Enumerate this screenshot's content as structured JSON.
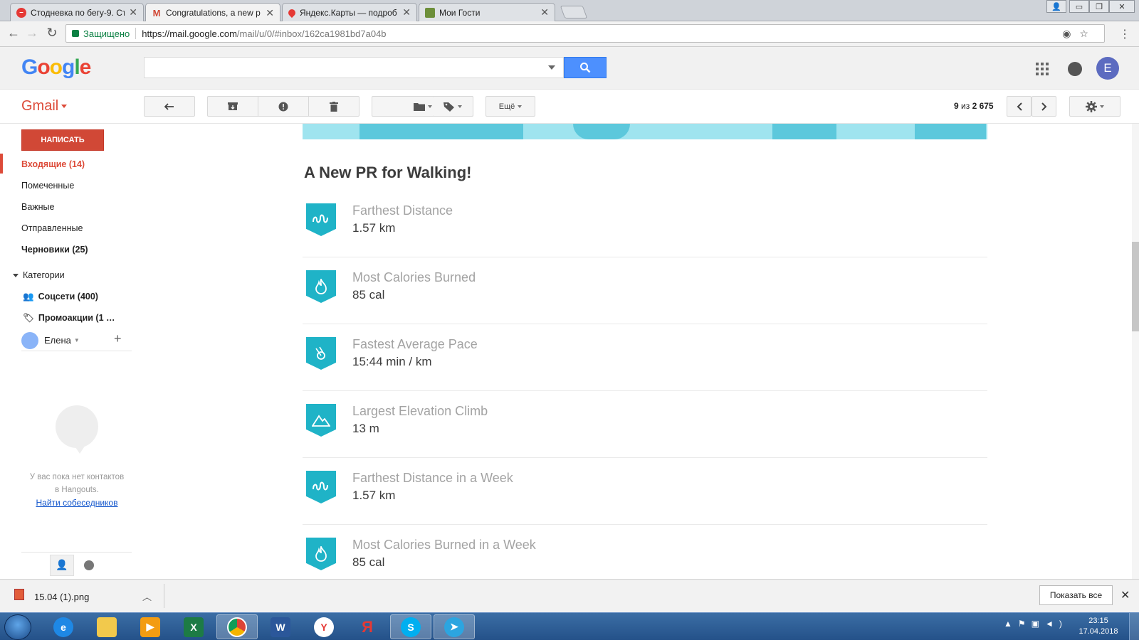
{
  "browser": {
    "tabs": [
      {
        "title": "Стодневка по бегу-9. Ст",
        "icon": "red-stop-icon",
        "color": "#e53935"
      },
      {
        "title": "Congratulations, a new p",
        "icon": "gmail-icon",
        "color": "#d14836",
        "active": true
      },
      {
        "title": "Яндекс.Карты — подроб",
        "icon": "map-pin-icon",
        "color": "#e53935"
      },
      {
        "title": "Мои Гости",
        "icon": "site-favicon",
        "color": "#6d8f3a"
      }
    ],
    "secure_label": "Защищено",
    "url_host": "https://mail.google.com",
    "url_path": "/mail/u/0/#inbox/162ca1981bd7a04b"
  },
  "header": {
    "logo_letters": [
      "G",
      "o",
      "o",
      "g",
      "l",
      "e"
    ],
    "avatar_letter": "E"
  },
  "toolbar": {
    "gmail_label": "Gmail",
    "more_label": "Ещё",
    "pager_current": "9",
    "pager_mid": " из ",
    "pager_total": "2 675"
  },
  "sidebar": {
    "compose_label": "НАПИСАТЬ",
    "items": [
      {
        "label": "Входящие (14)"
      },
      {
        "label": "Помеченные"
      },
      {
        "label": "Важные"
      },
      {
        "label": "Отправленные"
      },
      {
        "label": "Черновики (25)"
      }
    ],
    "categories_label": "Категории",
    "social_label": "Соцсети (400)",
    "promo_label": "Промоакции (1 …",
    "user_name": "Елена",
    "hangouts_text_1": "У вас пока нет контактов",
    "hangouts_text_2": "в Hangouts.",
    "hangouts_link": "Найти собеседников"
  },
  "mail": {
    "title": "A New PR for Walking!",
    "records": [
      {
        "label": "Farthest Distance",
        "value": "1.57 km",
        "icon": "route-icon"
      },
      {
        "label": "Most Calories Burned",
        "value": "85 cal",
        "icon": "flame-icon"
      },
      {
        "label": "Fastest Average Pace",
        "value": "15:44 min / km",
        "icon": "pace-icon"
      },
      {
        "label": "Largest Elevation Climb",
        "value": "13 m",
        "icon": "mountain-icon"
      },
      {
        "label": "Farthest Distance in a Week",
        "value": "1.57 km",
        "icon": "route-icon"
      },
      {
        "label": "Most Calories Burned in a Week",
        "value": "85 cal",
        "icon": "flame-icon"
      }
    ]
  },
  "downloads": {
    "file_name": "15.04 (1).png",
    "show_all_label": "Показать все"
  },
  "taskbar": {
    "time": "23:15",
    "date": "17.04.2018"
  },
  "colors": {
    "accent_red": "#dd4b39",
    "search_blue": "#4d90fe",
    "badge_teal": "#1fb3c7"
  }
}
